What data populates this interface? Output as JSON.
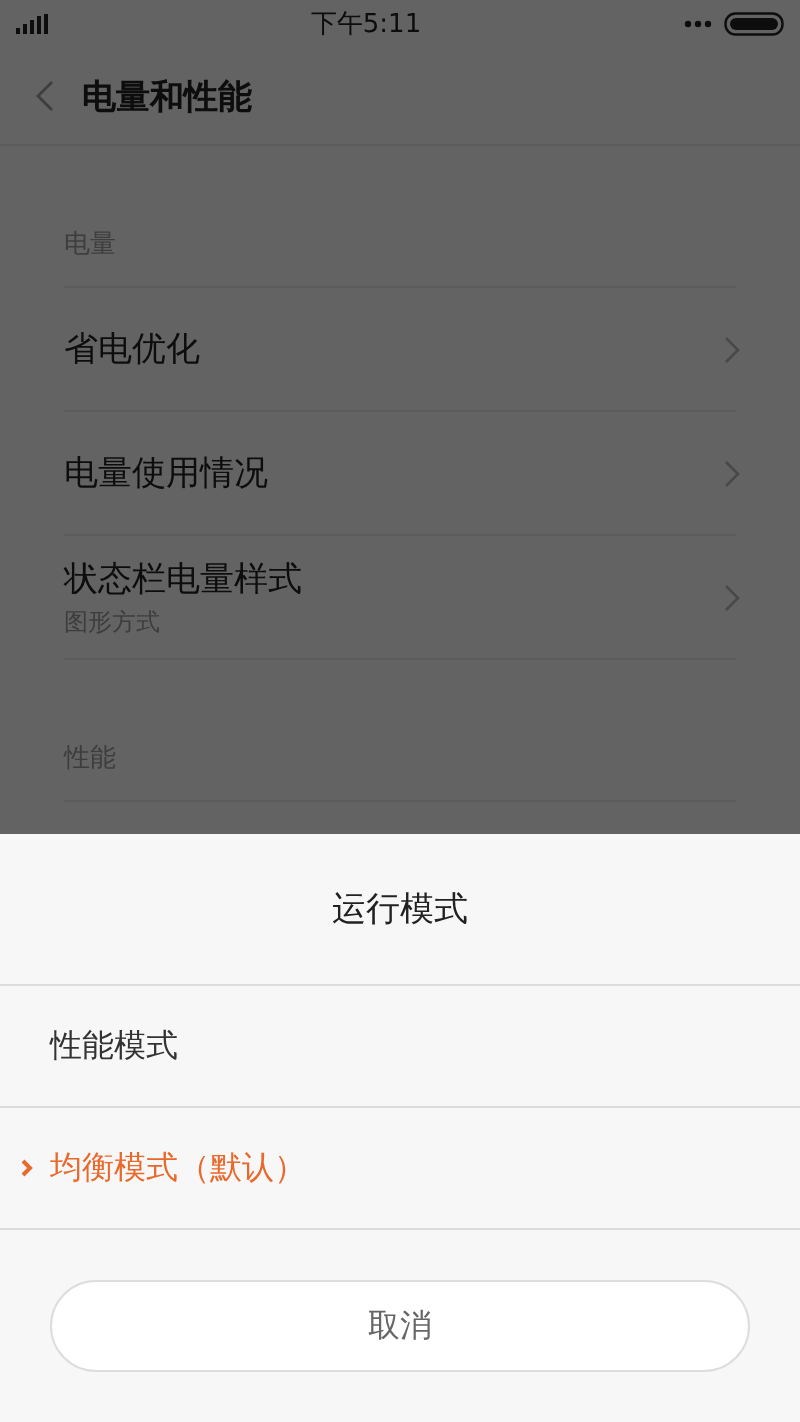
{
  "status_bar": {
    "time": "下午5:11"
  },
  "header": {
    "title": "电量和性能"
  },
  "sections": [
    {
      "title": "电量",
      "items": [
        {
          "title": "省电优化",
          "chevron": true
        },
        {
          "title": "电量使用情况",
          "chevron": true
        },
        {
          "title": "状态栏电量样式",
          "subtitle": "图形方式",
          "chevron": true
        }
      ]
    },
    {
      "title": "性能"
    }
  ],
  "sheet": {
    "title": "运行模式",
    "options": [
      {
        "label": "性能模式",
        "selected": false
      },
      {
        "label": "均衡模式（默认）",
        "selected": true
      }
    ],
    "cancel": "取消"
  }
}
